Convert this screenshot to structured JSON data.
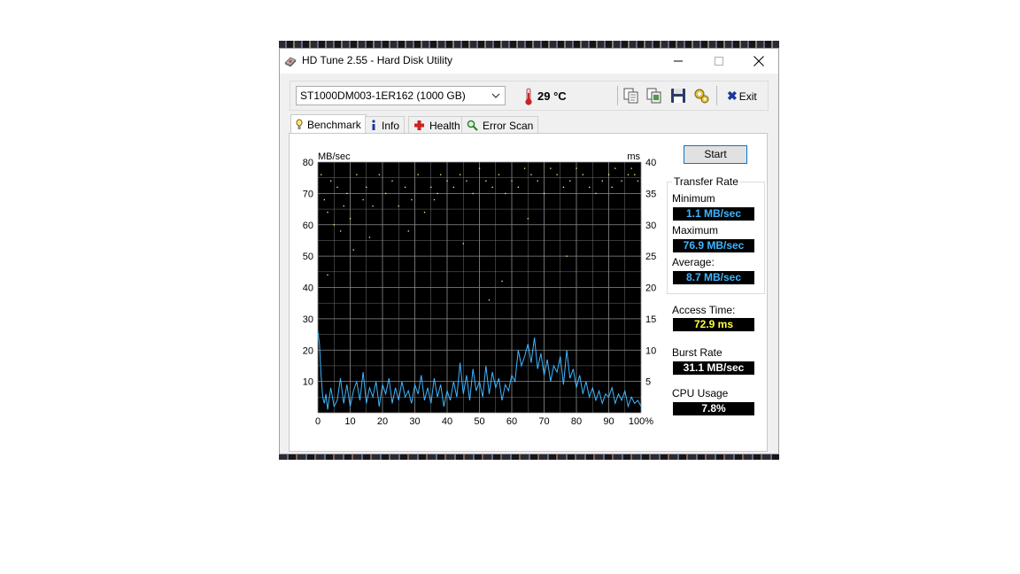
{
  "window": {
    "title": "HD Tune 2.55 - Hard Disk Utility",
    "minimize_glyph": "—",
    "maximize_glyph": "☐",
    "close_glyph": "✕"
  },
  "toolbar": {
    "drive": "ST1000DM003-1ER162 (1000 GB)",
    "temperature": "29 °C",
    "exit_label": "Exit",
    "icons": [
      "copy-info-icon",
      "copy-screenshot-icon",
      "save-icon",
      "options-icon",
      "exit-icon"
    ]
  },
  "tabs": [
    {
      "label": "Benchmark",
      "icon": "benchmark-icon",
      "active": true
    },
    {
      "label": "Info",
      "icon": "info-icon",
      "active": false
    },
    {
      "label": "Health",
      "icon": "health-icon",
      "active": false
    },
    {
      "label": "Error Scan",
      "icon": "error-scan-icon",
      "active": false
    }
  ],
  "benchmark": {
    "start_label": "Start",
    "transfer_rate": {
      "title": "Transfer Rate",
      "minimum_label": "Minimum",
      "minimum": "1.1 MB/sec",
      "maximum_label": "Maximum",
      "maximum": "76.9 MB/sec",
      "average_label": "Average:",
      "average": "8.7 MB/sec"
    },
    "access_time_label": "Access Time:",
    "access_time": "72.9 ms",
    "burst_rate_label": "Burst Rate",
    "burst_rate": "31.1 MB/sec",
    "cpu_usage_label": "CPU Usage",
    "cpu_usage": "7.8%"
  },
  "colors": {
    "plot_bg": "#000000",
    "grid": "#8c8c8c",
    "transfer_line": "#3fb6ff",
    "access_dots": "#ffff80",
    "value_blue": "#3fb6ff",
    "value_yellow": "#ffff40"
  },
  "chart_data": {
    "type": "line",
    "ylabel_left": "MB/sec",
    "ylabel_right": "ms",
    "x_ticks": [
      "0",
      "10",
      "20",
      "30",
      "40",
      "50",
      "60",
      "70",
      "80",
      "90",
      "100%"
    ],
    "y_ticks_left": [
      "10",
      "20",
      "30",
      "40",
      "50",
      "60",
      "70",
      "80"
    ],
    "y_ticks_right": [
      "5",
      "10",
      "15",
      "20",
      "25",
      "30",
      "35",
      "40"
    ],
    "xlim": [
      0,
      100
    ],
    "ylim_left": [
      0,
      80
    ],
    "ylim_right": [
      0,
      40
    ],
    "grid": true,
    "series": [
      {
        "kind": "transfer_rate",
        "x": [
          0,
          0.5,
          1,
          1.5,
          2,
          2.5,
          3,
          4,
          5,
          6,
          7,
          8,
          9,
          10,
          11,
          12,
          13,
          14,
          15,
          16,
          17,
          18,
          19,
          20,
          21,
          22,
          23,
          24,
          25,
          26,
          27,
          28,
          29,
          30,
          31,
          32,
          33,
          34,
          35,
          36,
          37,
          38,
          39,
          40,
          41,
          42,
          43,
          44,
          45,
          46,
          47,
          48,
          49,
          50,
          51,
          52,
          53,
          54,
          55,
          56,
          57,
          58,
          59,
          60,
          61,
          62,
          63,
          64,
          65,
          66,
          67,
          68,
          69,
          70,
          71,
          72,
          73,
          74,
          75,
          76,
          77,
          78,
          79,
          80,
          81,
          82,
          83,
          84,
          85,
          86,
          87,
          88,
          89,
          90,
          91,
          92,
          93,
          94,
          95,
          96,
          97,
          98,
          99,
          100
        ],
        "y": [
          26,
          22,
          12,
          5,
          3,
          6,
          1,
          8,
          2,
          4,
          11,
          3,
          9,
          2,
          7,
          10,
          4,
          13,
          3,
          8,
          5,
          10,
          2,
          9,
          6,
          11,
          3,
          8,
          4,
          10,
          5,
          7,
          3,
          9,
          6,
          12,
          4,
          8,
          3,
          11,
          5,
          9,
          2,
          7,
          4,
          10,
          5,
          16,
          6,
          12,
          4,
          14,
          7,
          10,
          5,
          15,
          6,
          13,
          8,
          11,
          4,
          9,
          7,
          12,
          10,
          20,
          15,
          18,
          22,
          16,
          24,
          14,
          19,
          12,
          17,
          10,
          15,
          13,
          18,
          9,
          20,
          11,
          14,
          8,
          12,
          6,
          10,
          5,
          8,
          4,
          7,
          3,
          6,
          5,
          8,
          3,
          6,
          4,
          7,
          2,
          5,
          3,
          4,
          2
        ]
      },
      {
        "kind": "access_time",
        "x": [
          1,
          2,
          3,
          4,
          5,
          6,
          7,
          8,
          9,
          10,
          12,
          14,
          15,
          17,
          19,
          21,
          23,
          25,
          27,
          29,
          31,
          33,
          35,
          36,
          37,
          38,
          40,
          42,
          44,
          46,
          48,
          50,
          52,
          54,
          56,
          58,
          60,
          62,
          64,
          66,
          68,
          70,
          72,
          74,
          76,
          78,
          80,
          82,
          84,
          86,
          88,
          90,
          91,
          92,
          94,
          96,
          97,
          98,
          99,
          57,
          3,
          11,
          16,
          28,
          45,
          53,
          65,
          77
        ],
        "y": [
          38,
          34,
          32,
          37,
          30,
          36,
          29,
          33,
          35,
          31,
          38,
          34,
          36,
          33,
          38,
          35,
          37,
          33,
          36,
          34,
          38,
          32,
          36,
          34,
          35,
          38,
          37,
          36,
          38,
          37,
          35,
          39,
          37,
          36,
          38,
          35,
          37,
          36,
          39,
          38,
          37,
          35,
          39,
          38,
          36,
          37,
          39,
          38,
          36,
          35,
          37,
          38,
          36,
          39,
          37,
          38,
          39,
          38,
          37,
          21,
          22,
          26,
          28,
          29,
          27,
          18,
          31,
          25
        ]
      }
    ]
  }
}
